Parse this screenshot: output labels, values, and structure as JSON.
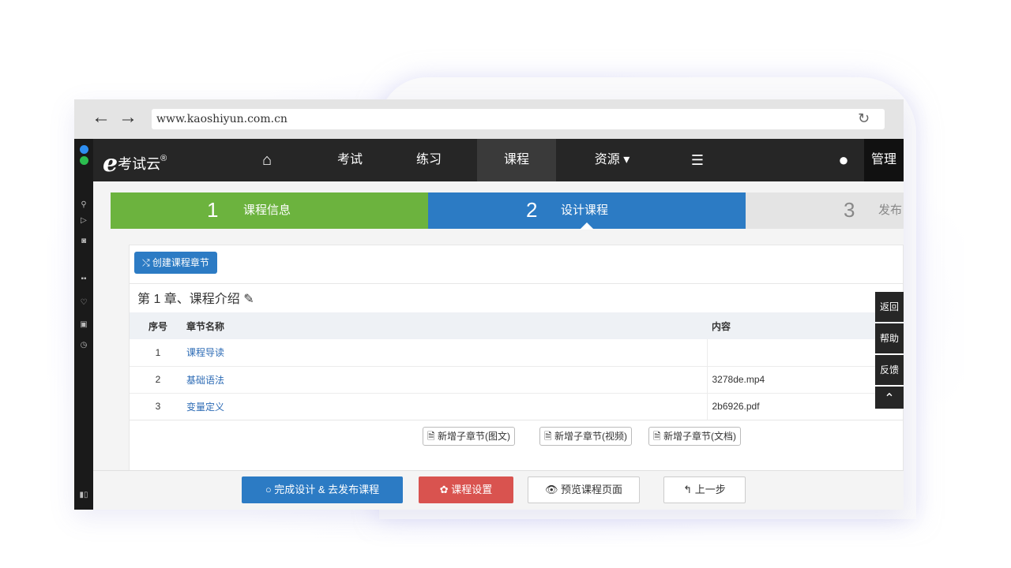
{
  "browser": {
    "back_icon": "←",
    "forward_icon": "→",
    "url": "www.kaoshiyun.com.cn",
    "reload_icon": "↻"
  },
  "leftbar": {
    "icons": [
      "chat-bubble-icon",
      "whatsapp-icon",
      "search-icon",
      "send-icon",
      "camera-icon",
      "apps-icon",
      "heart-icon",
      "wallet-icon",
      "clock-icon",
      "sidebar-toggle-icon"
    ]
  },
  "nav": {
    "logo_mark": "e",
    "logo_text": "考试云",
    "logo_reg": "®",
    "home_icon": "⌂",
    "items": [
      "考试",
      "练习",
      "课程",
      "资源 ▾"
    ],
    "list_icon": "☰",
    "user_icon": "●",
    "admin": "管理"
  },
  "steps": [
    {
      "num": "1",
      "label": "课程信息"
    },
    {
      "num": "2",
      "label": "设计课程"
    },
    {
      "num": "3",
      "label": "发布"
    }
  ],
  "create_button": "⤭ 创建课程章节",
  "chapter": {
    "title": "第 1 章、课程介绍 ✎",
    "columns": [
      "序号",
      "章节名称",
      "内容"
    ],
    "rows": [
      {
        "no": "1",
        "name": "课程导读",
        "content": ""
      },
      {
        "no": "2",
        "name": "基础语法",
        "content": "3278de.mp4"
      },
      {
        "no": "3",
        "name": "变量定义",
        "content": "2b6926.pdf"
      }
    ],
    "add_buttons": [
      "🗎 新增子章节(图文)",
      "🗎 新增子章节(视频)",
      "🗎 新增子章节(文档)"
    ]
  },
  "side_buttons": [
    "返回",
    "帮助",
    "反馈",
    "⌃"
  ],
  "bottom_buttons": {
    "finish": "○ 完成设计 & 去发布课程",
    "settings": "✿ 课程设置",
    "preview": "👁 预览课程页面",
    "prev": "↰ 上一步"
  },
  "colors": {
    "step1": "#6cb33e",
    "step2": "#2c7bc4",
    "nav_bg": "#262626",
    "danger": "#d9534f"
  }
}
